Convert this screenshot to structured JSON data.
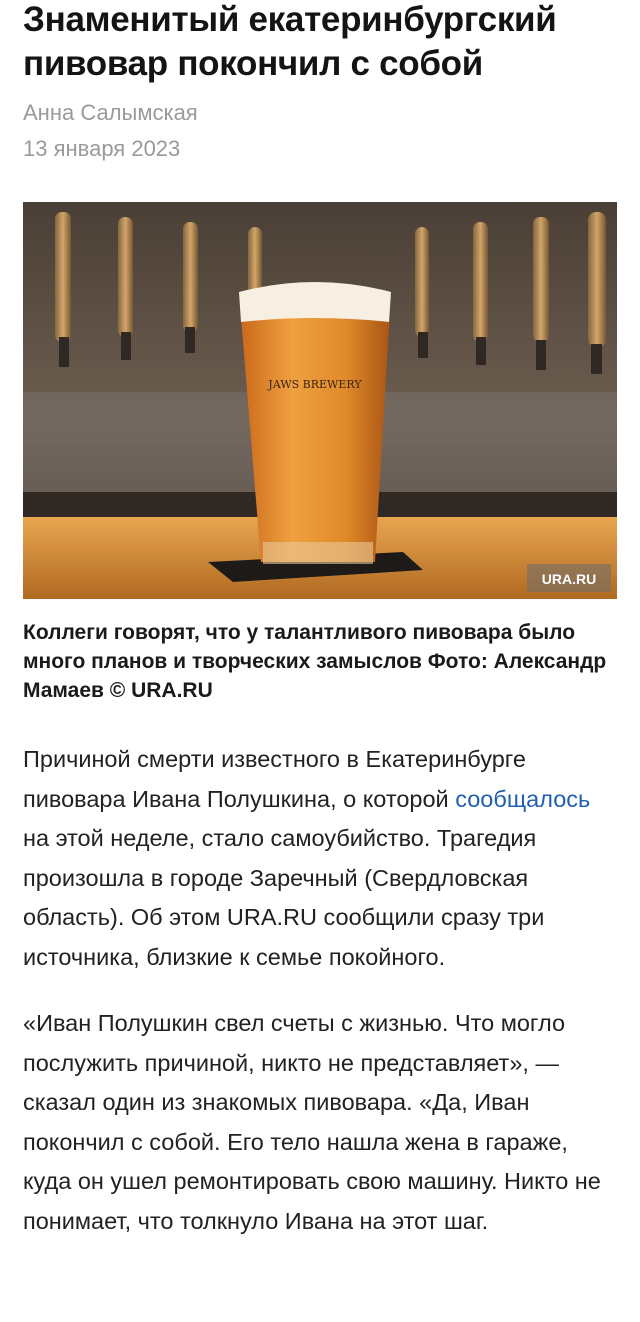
{
  "article": {
    "title": "Знаменитый екатеринбургский пивовар покончил с собой",
    "author": "Анна Салымская",
    "date": "13 января 2023"
  },
  "photo": {
    "glass_text": "JAWS BREWERY",
    "watermark": "URA.RU",
    "caption": "Коллеги говорят, что у талантливого пивовара было много планов и творческих замыслов Фото: Александр Мамаев © URA.RU"
  },
  "body": {
    "p1_before": "Причиной смерти известного в Екатеринбурге пивовара Ивана Полушкина, о которой ",
    "p1_link": "сообщалось",
    "p1_after": " на этой неделе, стало самоубийство. Трагедия произошла в городе Заречный (Свердловская область). Об этом URA.RU сообщили сразу три источника, близкие к семье покойного.",
    "p2": "«Иван Полушкин свел счеты с жизнью. Что могло послужить причиной, никто не представляет», — сказал один из знакомых пивовара. «Да, Иван покончил с собой. Его тело нашла жена в гараже, куда он ушел ремонтировать свою машину. Никто не понимает, что толкнуло Ивана на этот шаг."
  },
  "colors": {
    "link": "#2060b0",
    "meta_gray": "#9a9a9a"
  }
}
